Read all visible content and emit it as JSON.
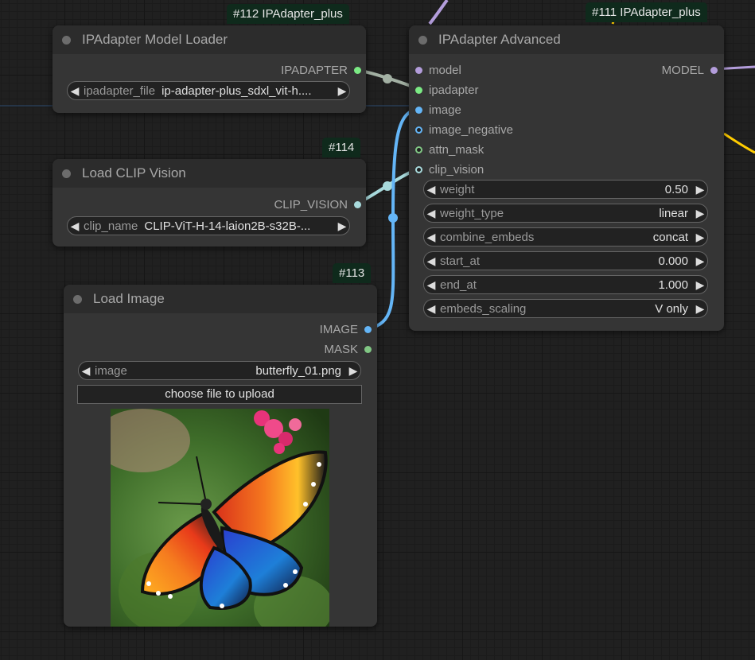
{
  "colors": {
    "model": "#b39ddb",
    "ipadapter": "#7bea84",
    "image": "#64b5f6",
    "mask": "#81c784",
    "clip_vision": "#a8dadc",
    "yellow": "#ffcc00"
  },
  "nodes": {
    "model_loader": {
      "badge": "#112 IPAdapter_plus",
      "title": "IPAdapter Model Loader",
      "output": "IPADAPTER",
      "widget": {
        "label": "ipadapter_file",
        "value": "ip-adapter-plus_sdxl_vit-h...."
      }
    },
    "clip_vision_loader": {
      "badge": "#114",
      "title": "Load CLIP Vision",
      "output": "CLIP_VISION",
      "widget": {
        "label": "clip_name",
        "value": "CLIP-ViT-H-14-laion2B-s32B-..."
      }
    },
    "load_image": {
      "badge": "#113",
      "title": "Load Image",
      "outputs": [
        "IMAGE",
        "MASK"
      ],
      "widget": {
        "label": "image",
        "value": "butterfly_01.png"
      },
      "upload_button": "choose file to upload"
    },
    "ipadapter_advanced": {
      "badge": "#111 IPAdapter_plus",
      "title": "IPAdapter Advanced",
      "inputs": [
        "model",
        "ipadapter",
        "image",
        "image_negative",
        "attn_mask",
        "clip_vision"
      ],
      "output": "MODEL",
      "widgets": [
        {
          "label": "weight",
          "value": "0.50"
        },
        {
          "label": "weight_type",
          "value": "linear"
        },
        {
          "label": "combine_embeds",
          "value": "concat"
        },
        {
          "label": "start_at",
          "value": "0.000"
        },
        {
          "label": "end_at",
          "value": "1.000"
        },
        {
          "label": "embeds_scaling",
          "value": "V only"
        }
      ]
    }
  }
}
